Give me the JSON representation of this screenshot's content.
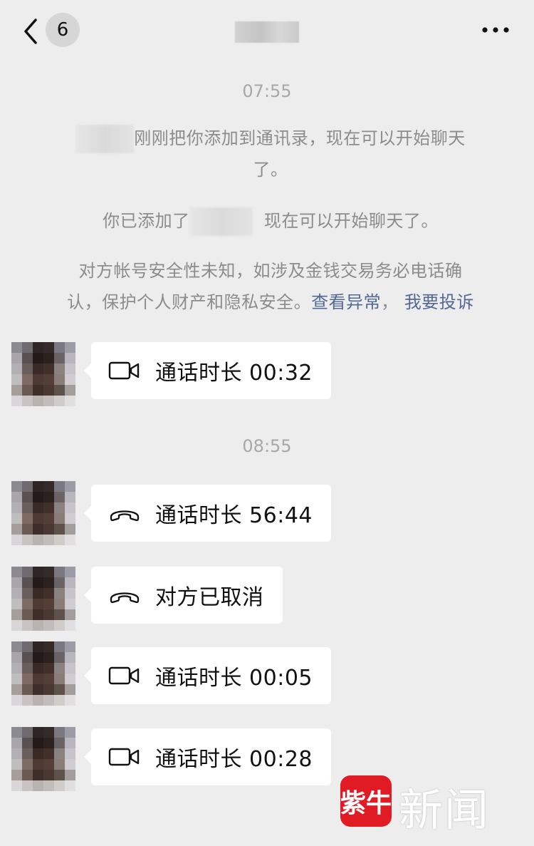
{
  "header": {
    "unread_count": "6",
    "title": ""
  },
  "messages_meta": {
    "time_1": "07:55",
    "time_2": "08:55"
  },
  "system": {
    "added_notice_after_name": "刚刚把你添加到通讯录，现在可以开始聊天",
    "added_notice_tail": "了。",
    "you_added_prefix": "你已添加了",
    "you_added_suffix": "现在可以开始聊天了。",
    "security_line1": "对方帐号安全性未知，如涉及金钱交易务必电话确",
    "security_line2_prefix": "认，保护个人财产和隐私安全。",
    "link_view_abnormal": "查看异常",
    "separator": "，",
    "link_report": "我要投诉"
  },
  "calls": [
    {
      "icon": "video-call-icon",
      "text": "通话时长 00:32"
    },
    {
      "icon": "phone-hangup-icon",
      "text": "通话时长 56:44"
    },
    {
      "icon": "phone-hangup-icon",
      "text": "对方已取消"
    },
    {
      "icon": "video-call-icon",
      "text": "通话时长 00:05"
    },
    {
      "icon": "video-call-icon",
      "text": "通话时长 00:28"
    }
  ],
  "watermark": {
    "logo_text": "紫牛",
    "text": "新闻"
  },
  "colors": {
    "background": "#ededed",
    "bubble": "#ffffff",
    "link": "#536895",
    "system_text": "#8c8c8c",
    "watermark_red": "#e01b24"
  }
}
